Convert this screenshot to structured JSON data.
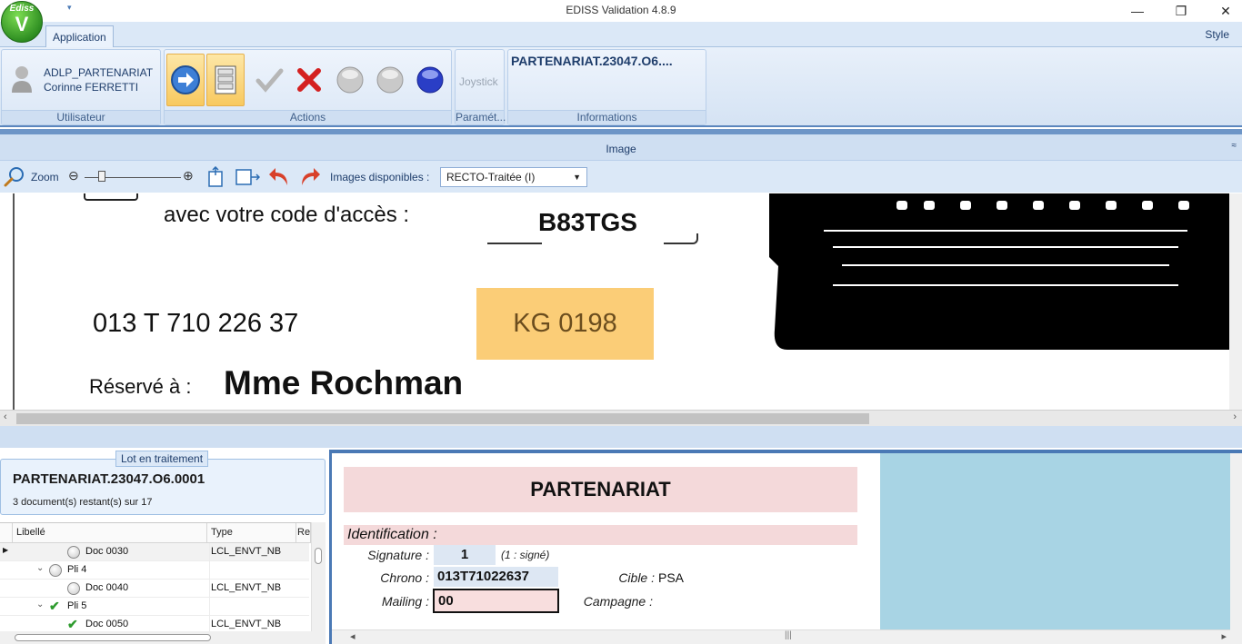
{
  "window": {
    "title": "EDISS Validation 4.8.9",
    "minimize": "—",
    "maximize": "❐",
    "close": "✕"
  },
  "logo": {
    "line1": "Ediss",
    "line2": "V"
  },
  "ribbon": {
    "tab_application": "Application",
    "tab_style": "Style",
    "user": {
      "login": "ADLP_PARTENARIAT",
      "name": "Corinne FERRETTI",
      "group_label": "Utilisateur"
    },
    "actions": {
      "group_label": "Actions"
    },
    "params": {
      "joystick": "Joystick",
      "group_label": "Paramét..."
    },
    "info": {
      "title": "PARTENARIAT.23047.O6....",
      "group_label": "Informations"
    }
  },
  "image_panel": {
    "header": "Image",
    "zoom_label": "Zoom",
    "images_label": "Images disponibles :",
    "images_selected": "RECTO-Traitée (I)",
    "doc": {
      "code_text": "avec votre code d'accès :",
      "code_value": "B83TGS",
      "phone": "013 T 710 226 37",
      "box_code": "KG 0198",
      "reserved_prefix": "Réservé à :",
      "reserved_name": "Mme Rochman"
    }
  },
  "lot": {
    "tag": "Lot en traitement",
    "name": "PARTENARIAT.23047.O6.0001",
    "remaining": "3 document(s) restant(s) sur 17",
    "columns": [
      "Libellé",
      "Type",
      "Re"
    ],
    "rows": [
      {
        "label": "Doc 0030",
        "type": "LCL_ENVT_NB"
      },
      {
        "label": "Pli 4",
        "type": ""
      },
      {
        "label": "Doc 0040",
        "type": "LCL_ENVT_NB"
      },
      {
        "label": "Pli 5",
        "type": ""
      },
      {
        "label": "Doc 0050",
        "type": "LCL_ENVT_NB"
      }
    ]
  },
  "form": {
    "title": "PARTENARIAT",
    "section": "Identification :",
    "signature_label": "Signature :",
    "signature_value": "1",
    "signature_hint": "(1 : signé)",
    "chrono_label": "Chrono :",
    "chrono_value": "013T71022637",
    "cible_label": "Cible :",
    "cible_value": "PSA",
    "mailing_label": "Mailing :",
    "mailing_value": "00",
    "campagne_label": "Campagne :"
  },
  "colors": {
    "accent": "#5b86bd",
    "active_button": "#f8c95f",
    "form_header": "#f4d9da",
    "form_bg": "#a8d4e4"
  }
}
